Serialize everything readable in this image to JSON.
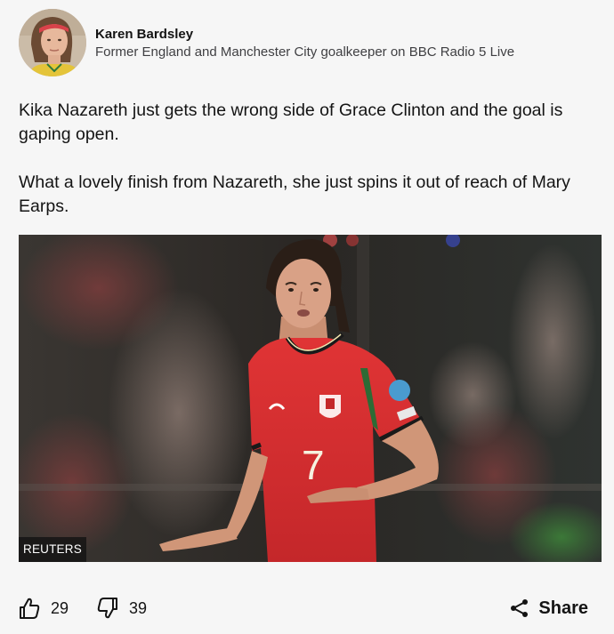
{
  "author": {
    "name": "Karen Bardsley",
    "role": "Former England and Manchester City goalkeeper on BBC Radio 5 Live"
  },
  "post": {
    "paragraphs": [
      "Kika Nazareth just gets the wrong side of Grace Clinton and the goal is gaping open.",
      "What a lovely finish from Nazareth, she just spins it out of reach of Mary Earps."
    ]
  },
  "image": {
    "credit": "REUTERS",
    "shirt_number": "7"
  },
  "reactions": {
    "likes": "29",
    "dislikes": "39"
  },
  "share": {
    "label": "Share"
  },
  "colors": {
    "background": "#f6f6f6",
    "text": "#141414",
    "shirt_red": "#d32a2d"
  }
}
